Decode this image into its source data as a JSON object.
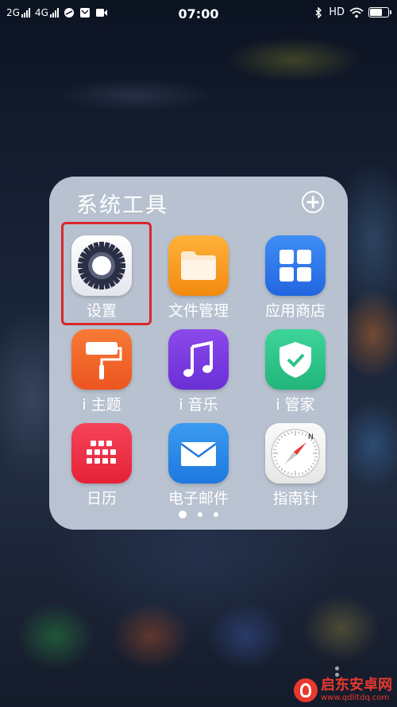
{
  "status_bar": {
    "net1": "2G",
    "net2": "4G",
    "time": "07:00",
    "hd": "HD",
    "battery_level": 0.75
  },
  "folder": {
    "title": "系统工具",
    "apps": [
      {
        "label": "设置",
        "icon": "settings-gear-icon",
        "selected": true
      },
      {
        "label": "文件管理",
        "icon": "folder-icon"
      },
      {
        "label": "应用商店",
        "icon": "app-store-grid-icon"
      },
      {
        "label": "i 主题",
        "icon": "paint-roller-icon"
      },
      {
        "label": "i 音乐",
        "icon": "music-note-icon"
      },
      {
        "label": "i 管家",
        "icon": "shield-check-icon"
      },
      {
        "label": "日历",
        "icon": "calendar-grid-icon"
      },
      {
        "label": "电子邮件",
        "icon": "envelope-icon"
      },
      {
        "label": "指南针",
        "icon": "compass-icon"
      }
    ],
    "pages": 3,
    "active_page": 1
  },
  "colors": {
    "highlight": "#d8262c",
    "files": "#f59b1e",
    "store": "#2f7cf0",
    "theme": "#f26a2b",
    "music": "#7a3ce0",
    "manager": "#2ec48a",
    "calendar": "#ef2f45",
    "mail": "#2b8bea"
  },
  "watermark": {
    "name": "启东安卓网",
    "url": "www.qdlitdq.com"
  }
}
